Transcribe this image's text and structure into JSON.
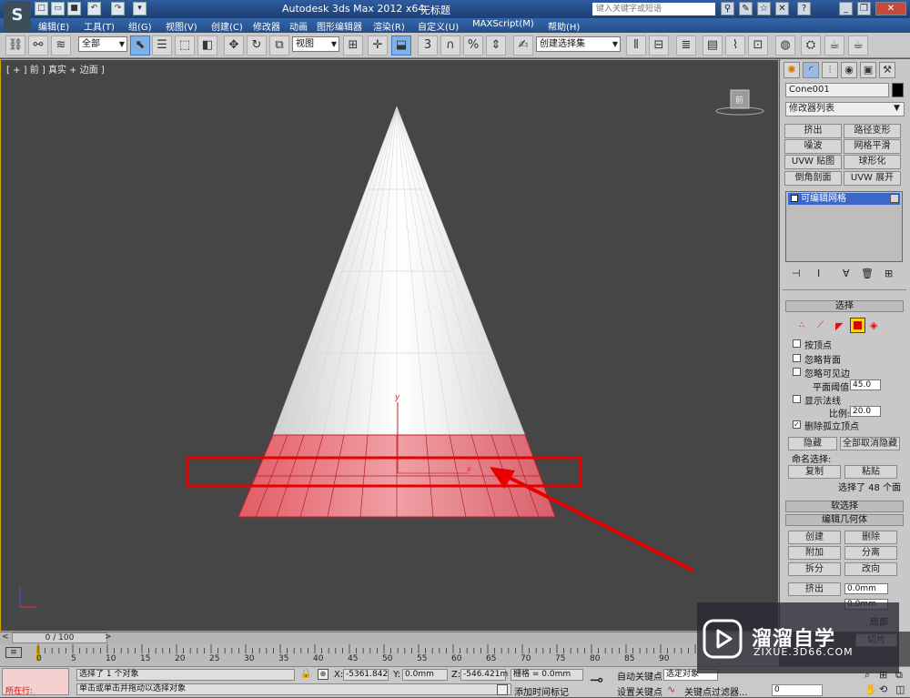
{
  "titlebar": {
    "app_title": "Autodesk 3ds Max  2012 x64",
    "doc_title": "无标题",
    "search_placeholder": "键入关键字或短语"
  },
  "menus": [
    "编辑(E)",
    "工具(T)",
    "组(G)",
    "视图(V)",
    "创建(C)",
    "修改器",
    "动画",
    "图形编辑器",
    "渲染(R)",
    "自定义(U)",
    "MAXScript(M)",
    "帮助(H)"
  ],
  "toolbar": {
    "selection_filter": "全部",
    "ref_coord": "视图",
    "named_selection": "创建选择集"
  },
  "viewport": {
    "label": "[ + ] 前 ] 真实 + 边面 ]",
    "axis_y": "y",
    "axis_x": "x",
    "viewcube_label": "前"
  },
  "command_panel": {
    "object_name": "Cone001",
    "modifier_list": "修改器列表",
    "modifier_buttons": [
      "挤出",
      "路径变形",
      "噪波",
      "网格平滑",
      "UVW 贴图",
      "球形化",
      "倒角剖面",
      "UVW 展开"
    ],
    "stack_item": "可编辑网格",
    "selection_rollout": "选择",
    "by_vertex": "按顶点",
    "ignore_backfacing": "忽略背面",
    "ignore_visible_edges": "忽略可见边",
    "planar_threshold_label": "平面阈值:",
    "planar_threshold": "45.0",
    "show_normals": "显示法线",
    "scale_label": "比例:",
    "scale": "20.0",
    "delete_isolated": "删除孤立顶点",
    "hide_btn": "隐藏",
    "unhide_all_btn": "全部取消隐藏",
    "named_sel_label": "命名选择:",
    "copy_btn": "复制",
    "paste_btn": "粘贴",
    "selected_info": "选择了 48 个面",
    "soft_selection": "软选择",
    "edit_geometry": "编辑几何体",
    "create_btn": "创建",
    "delete_btn": "删除",
    "attach_btn": "附加",
    "detach_btn": "分离",
    "split_btn": "拆分",
    "turn_btn": "改向",
    "extrude_btn": "挤出",
    "extrude_value": "0.0mm",
    "chamfer_value": "0.0mm",
    "local_label": "局部",
    "slice_btn": "切片"
  },
  "timeline": {
    "frame_display": "0 / 100",
    "ticks": [
      "0",
      "5",
      "10",
      "15",
      "20",
      "25",
      "30",
      "35",
      "40",
      "45",
      "50",
      "55",
      "60",
      "65",
      "70",
      "75",
      "80",
      "85",
      "90"
    ]
  },
  "statusbar": {
    "running_label": "所在行:",
    "status_line1": "选择了 1 个对象",
    "status_line2": "单击或单击并拖动以选择对象",
    "x_label": "X:",
    "x_value": "-5361.842",
    "y_label": "Y:",
    "y_value": "0.0mm",
    "z_label": "Z:",
    "z_value": "-546.421m",
    "grid_label": "栅格 = 0.0mm",
    "add_time_tag": "添加时间标记",
    "auto_key": "自动关键点",
    "set_key": "设置关键点",
    "selected_object": "选定对象",
    "key_filter": "关键点过滤器...",
    "frame_value": "0"
  },
  "watermark": {
    "brand": "溜溜自学",
    "url": "ZIXUE.3D66.COM"
  },
  "colors": {
    "viewport_bg": "#464646",
    "selection_red": "#e60000",
    "stack_blue": "#3b67c9"
  }
}
